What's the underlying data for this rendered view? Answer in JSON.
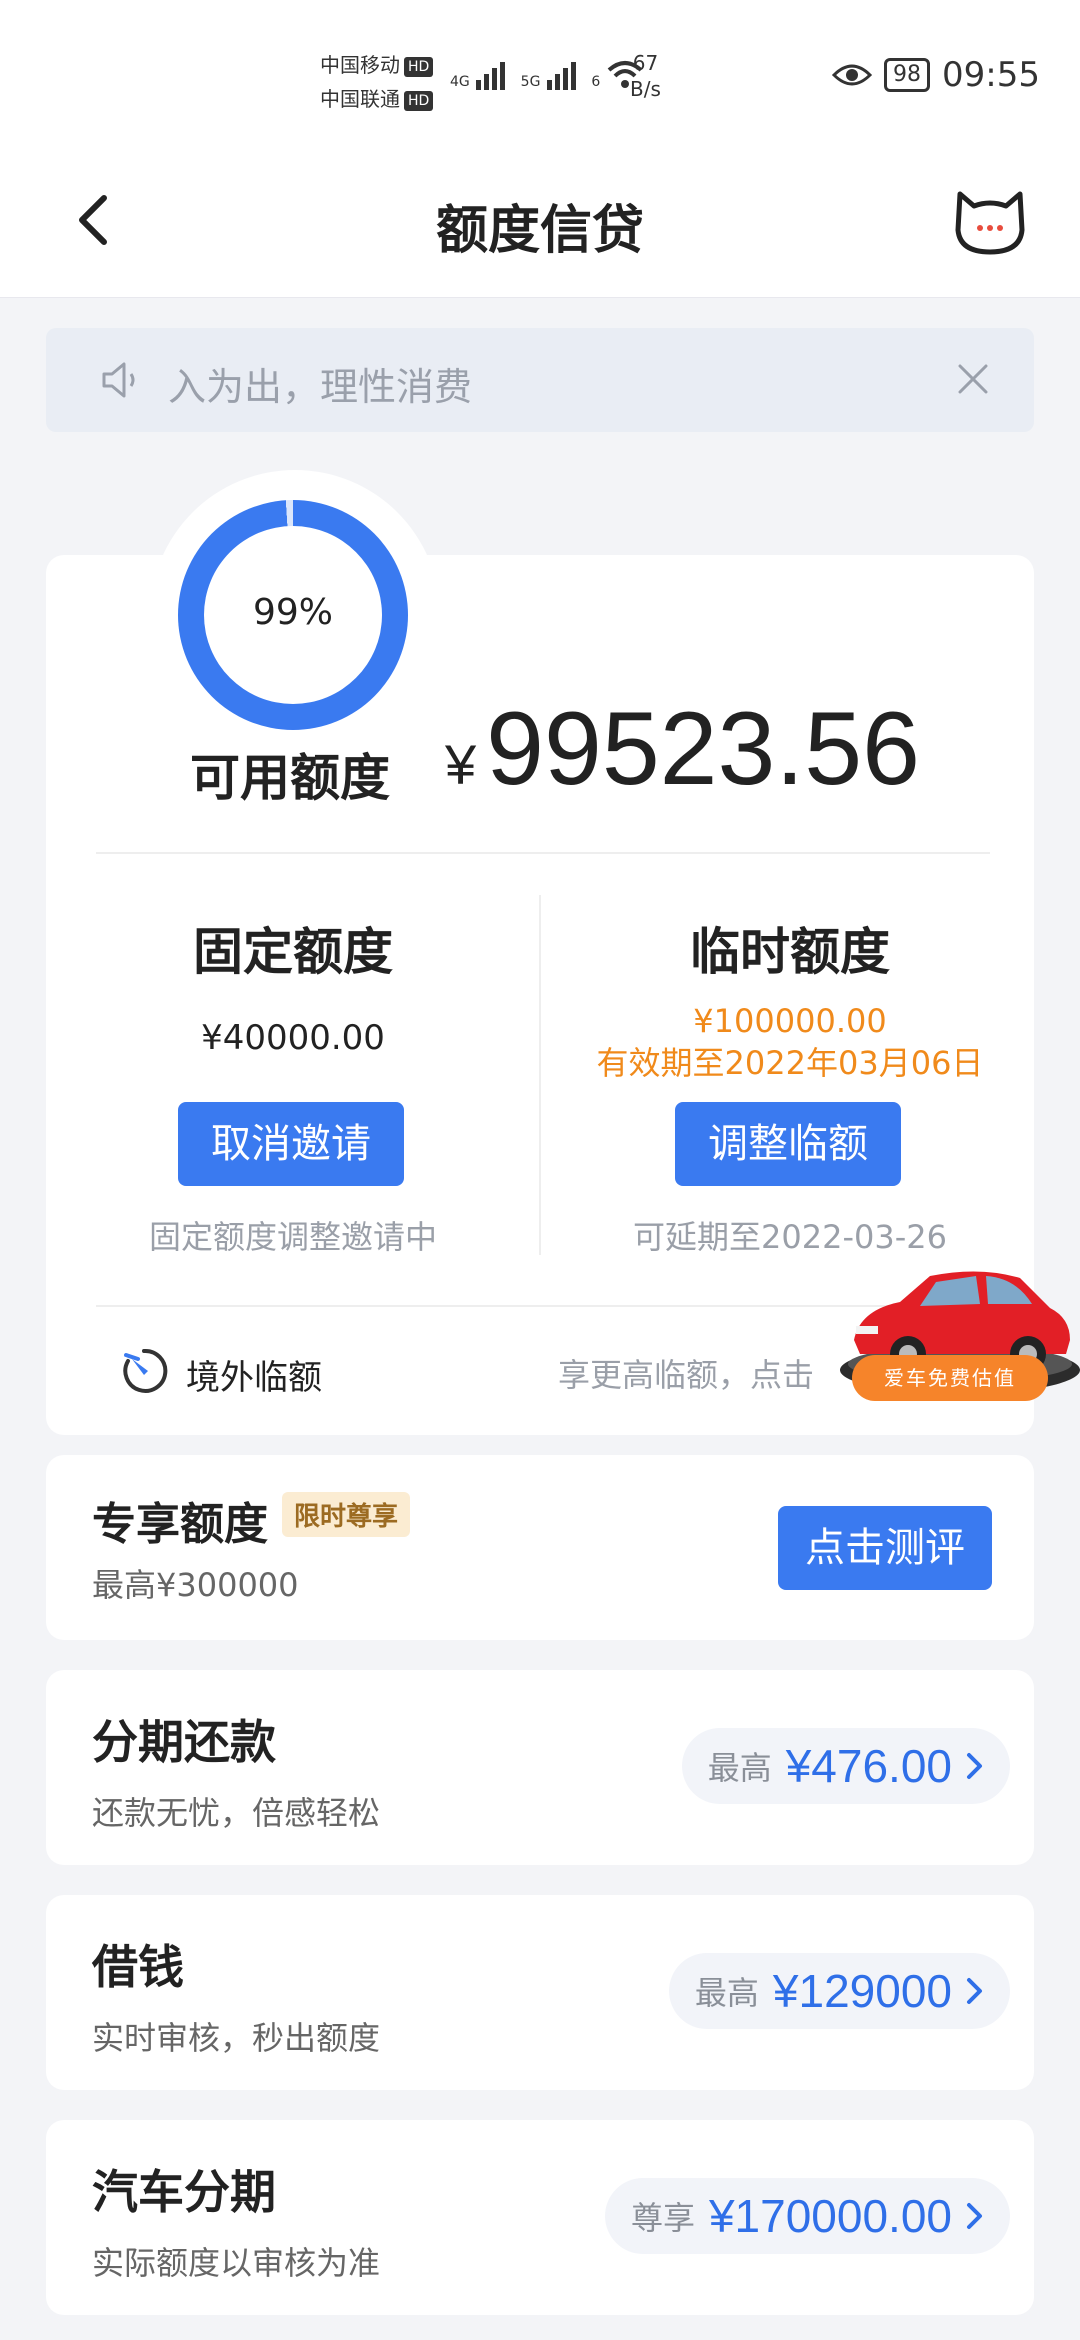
{
  "status_bar": {
    "carrier1": "中国移动",
    "carrier2": "中国联通",
    "hd": "HD",
    "signal1": "4G",
    "signal2": "5G",
    "signal3": "6",
    "net_speed_value": "67",
    "net_speed_unit": "B/s",
    "battery": "98",
    "time": "09:55"
  },
  "header": {
    "title": "额度信贷"
  },
  "notice": {
    "text": "入为出，理性消费"
  },
  "credit": {
    "percent": "99%",
    "percent_value": 99,
    "available_label": "可用额度",
    "currency": "¥",
    "available_amount": "99523.56",
    "fixed": {
      "title": "固定额度",
      "amount": "¥40000.00",
      "button": "取消邀请",
      "note": "固定额度调整邀请中"
    },
    "temporary": {
      "title": "临时额度",
      "amount": "¥100000.00",
      "validity": "有效期至2022年03月06日",
      "button": "调整临额",
      "note": "可延期至2022-03-26"
    },
    "overseas": {
      "label": "境外临额",
      "hint": "享更高临额，点击"
    }
  },
  "car_ad": {
    "label": "爱车免费估值"
  },
  "exclusive": {
    "title": "专享额度",
    "badge": "限时尊享",
    "subtitle": "最高¥300000",
    "button": "点击测评"
  },
  "products": [
    {
      "title": "分期还款",
      "subtitle": "还款无忧，倍感轻松",
      "pill_prefix": "最高",
      "pill_amount": "¥476.00"
    },
    {
      "title": "借钱",
      "subtitle": "实时审核，秒出额度",
      "pill_prefix": "最高",
      "pill_amount": "¥129000"
    },
    {
      "title": "汽车分期",
      "subtitle": "实际额度以审核为准",
      "pill_prefix": "尊享",
      "pill_amount": "¥170000.00"
    }
  ],
  "colors": {
    "accent_blue": "#3a7af0",
    "orange": "#f08a1b",
    "background": "#f3f4f7"
  },
  "icons": [
    "back-arrow-icon",
    "cat-mascot-icon",
    "speaker-icon",
    "close-icon",
    "overseas-plane-icon",
    "chevron-right-icon",
    "wifi-icon",
    "eye-icon"
  ]
}
